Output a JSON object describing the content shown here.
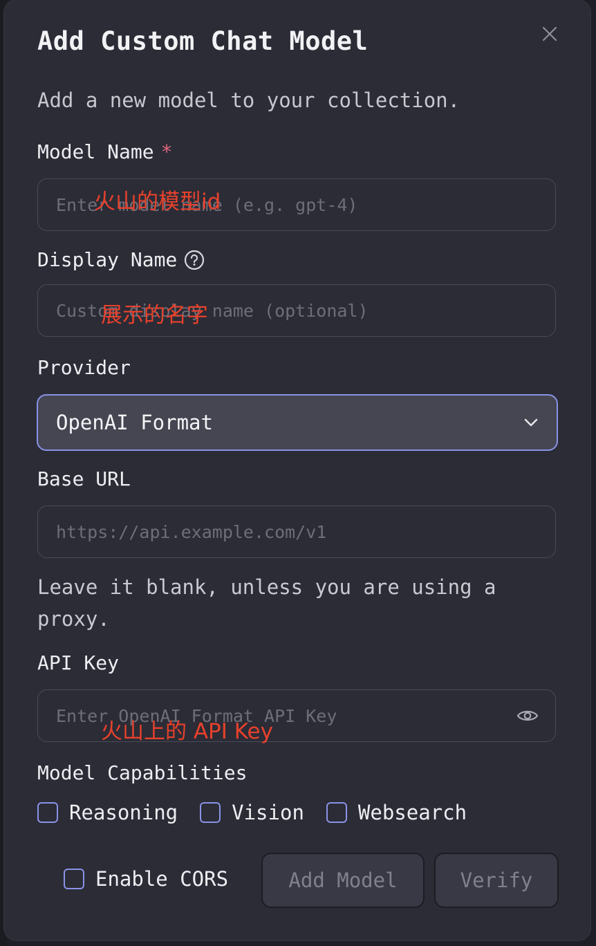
{
  "dialog": {
    "title": "Add Custom Chat Model",
    "subtitle": "Add a new model to your collection.",
    "close_icon": "close-icon"
  },
  "fields": {
    "model_name": {
      "label": "Model Name",
      "required_marker": "*",
      "value": "",
      "placeholder": "Enter model name (e.g. gpt-4)",
      "annotation": "火山的模型id"
    },
    "display_name": {
      "label": "Display Name",
      "help_icon": "help-circle-icon",
      "value": "",
      "placeholder": "Custom display name (optional)",
      "annotation": "展示的名字"
    },
    "provider": {
      "label": "Provider",
      "selected": "OpenAI Format",
      "icon": "chevron-down-icon"
    },
    "base_url": {
      "label": "Base URL",
      "value": "",
      "placeholder": "https://api.example.com/v1",
      "hint": "Leave it blank, unless you are using a proxy."
    },
    "api_key": {
      "label": "API Key",
      "value": "",
      "placeholder": "Enter OpenAI Format API Key",
      "icon": "eye-icon",
      "annotation": "火山上的 API Key"
    }
  },
  "capabilities": {
    "label": "Model Capabilities",
    "items": [
      {
        "label": "Reasoning",
        "checked": false
      },
      {
        "label": "Vision",
        "checked": false
      },
      {
        "label": "Websearch",
        "checked": false
      }
    ]
  },
  "footer": {
    "cors_label": "Enable CORS",
    "cors_checked": false,
    "add_button": "Add Model",
    "verify_button": "Verify"
  },
  "colors": {
    "dialog_bg": "#2b2c36",
    "accent": "#8b92e8",
    "required": "#e0667a",
    "annotation": "#e8412c"
  }
}
